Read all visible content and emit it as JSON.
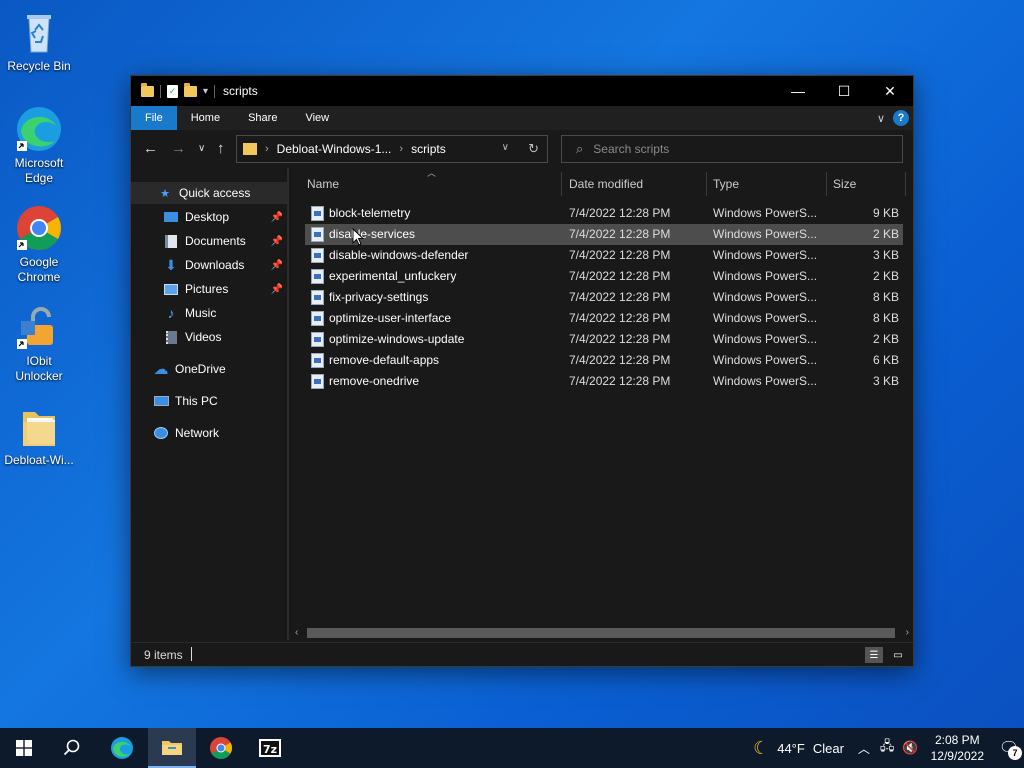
{
  "desktop": {
    "icons": [
      {
        "label": "Recycle Bin",
        "icon": "recycle-bin-icon"
      },
      {
        "label": "Microsoft Edge",
        "icon": "edge-icon"
      },
      {
        "label": "Google Chrome",
        "icon": "chrome-icon"
      },
      {
        "label": "IObit Unlocker",
        "icon": "iobit-unlocker-icon"
      },
      {
        "label": "Debloat-Wi...",
        "icon": "folder-icon"
      }
    ]
  },
  "window": {
    "title": "scripts",
    "controls": {
      "minimize": "—",
      "maximize": "☐",
      "close": "✕"
    },
    "ribbon": {
      "tabs": [
        "File",
        "Home",
        "Share",
        "View"
      ]
    },
    "address": {
      "crumbs": [
        "Debloat-Windows-1...",
        "scripts"
      ]
    },
    "search": {
      "placeholder": "Search scripts"
    },
    "sidebar": {
      "items": [
        {
          "label": "Quick access",
          "icon": "star-icon",
          "pinned": false
        },
        {
          "label": "Desktop",
          "icon": "desktop-icon",
          "pinned": true
        },
        {
          "label": "Documents",
          "icon": "documents-icon",
          "pinned": true
        },
        {
          "label": "Downloads",
          "icon": "downloads-icon",
          "pinned": true
        },
        {
          "label": "Pictures",
          "icon": "pictures-icon",
          "pinned": true
        },
        {
          "label": "Music",
          "icon": "music-icon",
          "pinned": false
        },
        {
          "label": "Videos",
          "icon": "videos-icon",
          "pinned": false
        },
        {
          "label": "OneDrive",
          "icon": "onedrive-icon",
          "pinned": false
        },
        {
          "label": "This PC",
          "icon": "this-pc-icon",
          "pinned": false
        },
        {
          "label": "Network",
          "icon": "network-icon",
          "pinned": false
        }
      ]
    },
    "columns": {
      "name": "Name",
      "date": "Date modified",
      "type": "Type",
      "size": "Size"
    },
    "files": [
      {
        "name": "block-telemetry",
        "date": "7/4/2022 12:28 PM",
        "type": "Windows PowerS...",
        "size": "9 KB"
      },
      {
        "name": "disable-services",
        "date": "7/4/2022 12:28 PM",
        "type": "Windows PowerS...",
        "size": "2 KB"
      },
      {
        "name": "disable-windows-defender",
        "date": "7/4/2022 12:28 PM",
        "type": "Windows PowerS...",
        "size": "3 KB"
      },
      {
        "name": "experimental_unfuckery",
        "date": "7/4/2022 12:28 PM",
        "type": "Windows PowerS...",
        "size": "2 KB"
      },
      {
        "name": "fix-privacy-settings",
        "date": "7/4/2022 12:28 PM",
        "type": "Windows PowerS...",
        "size": "8 KB"
      },
      {
        "name": "optimize-user-interface",
        "date": "7/4/2022 12:28 PM",
        "type": "Windows PowerS...",
        "size": "8 KB"
      },
      {
        "name": "optimize-windows-update",
        "date": "7/4/2022 12:28 PM",
        "type": "Windows PowerS...",
        "size": "2 KB"
      },
      {
        "name": "remove-default-apps",
        "date": "7/4/2022 12:28 PM",
        "type": "Windows PowerS...",
        "size": "6 KB"
      },
      {
        "name": "remove-onedrive",
        "date": "7/4/2022 12:28 PM",
        "type": "Windows PowerS...",
        "size": "3 KB"
      }
    ],
    "hovered_row": 1,
    "status": {
      "item_count": "9 items"
    }
  },
  "taskbar": {
    "weather": {
      "temp": "44°F",
      "condition": "Clear"
    },
    "clock": {
      "time": "2:08 PM",
      "date": "12/9/2022"
    },
    "notifications": "7"
  },
  "colors": {
    "accent": "#1979ca",
    "desktop": "#0a5fd2"
  }
}
